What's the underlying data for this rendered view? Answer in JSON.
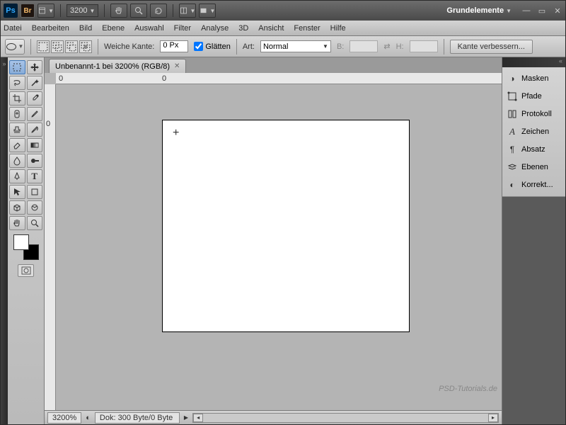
{
  "topbar": {
    "zoom": "3200",
    "workspace": "Grundelemente"
  },
  "menu": [
    "Datei",
    "Bearbeiten",
    "Bild",
    "Ebene",
    "Auswahl",
    "Filter",
    "Analyse",
    "3D",
    "Ansicht",
    "Fenster",
    "Hilfe"
  ],
  "options": {
    "feather_label": "Weiche Kante:",
    "feather_value": "0 Px",
    "antialias": "Glätten",
    "style_label": "Art:",
    "style_value": "Normal",
    "w_label": "B:",
    "h_label": "H:",
    "refine": "Kante verbessern..."
  },
  "tab": {
    "title": "Unbenannt-1 bei 3200% (RGB/8)"
  },
  "ruler": {
    "h0": "0",
    "h1": "0",
    "v0": "0"
  },
  "panels": [
    {
      "icon": "masks",
      "label": "Masken"
    },
    {
      "icon": "paths",
      "label": "Pfade"
    },
    {
      "icon": "history",
      "label": "Protokoll"
    },
    {
      "icon": "char",
      "label": "Zeichen"
    },
    {
      "icon": "para",
      "label": "Absatz"
    },
    {
      "icon": "layers",
      "label": "Ebenen"
    },
    {
      "icon": "adjust",
      "label": "Korrekt..."
    }
  ],
  "status": {
    "zoom": "3200%",
    "doc": "Dok: 300 Byte/0 Byte"
  },
  "watermark": "PSD-Tutorials.de"
}
